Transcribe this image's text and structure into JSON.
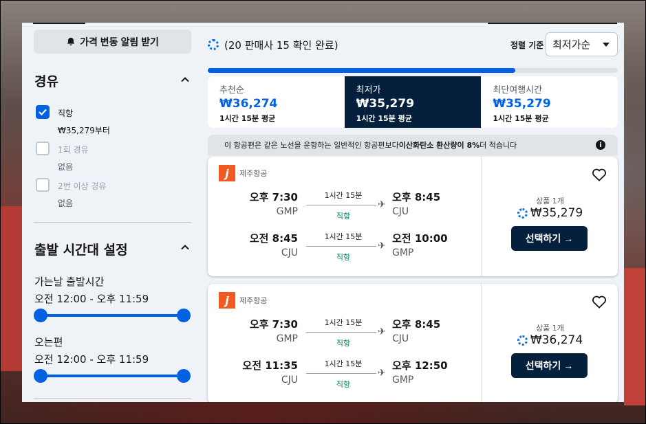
{
  "sidebar": {
    "alert_button": "가격 변동 알림 받기",
    "stops": {
      "title": "경유",
      "items": [
        {
          "label": "직항",
          "sub": "₩35,279부터",
          "checked": true,
          "disabled": false
        },
        {
          "label": "1회 경유",
          "sub": "없음",
          "checked": false,
          "disabled": true
        },
        {
          "label": "2번 이상 경유",
          "sub": "없음",
          "checked": false,
          "disabled": true
        }
      ]
    },
    "departure_times": {
      "title": "출발 시간대 설정",
      "outbound_label": "가는날 출발시간",
      "outbound_range": "오전 12:00 - 오후 11:59",
      "inbound_label": "오는편",
      "inbound_range": "오전 12:00 - 오후 11:59"
    }
  },
  "main": {
    "status": "(20 판매사 15 확인 완료)",
    "sort_label": "정렬 기준",
    "sort_value": "최저가순",
    "progress_fraction": 0.75,
    "tabs": [
      {
        "label": "추천순",
        "price": "₩36,274",
        "duration": "1시간 15분 평균",
        "active": false
      },
      {
        "label": "최저가",
        "price": "₩35,279",
        "duration": "1시간 15분 평균",
        "active": true
      },
      {
        "label": "최단여행시간",
        "price": "₩35,279",
        "duration": "1시간 15분 평균",
        "active": false
      }
    ],
    "eco_notice": {
      "prefix": "이 항공편은 같은 노선을 운항하는 일반적인 항공편보다 ",
      "highlight": "이산화탄소 환산량이 8%",
      "suffix": " 더 적습니다"
    },
    "results": [
      {
        "airline": "제주항공",
        "logo_letter": "j",
        "legs": [
          {
            "dep_time": "오후 7:30",
            "dep_code": "GMP",
            "duration": "1시간 15분",
            "stops": "직항",
            "arr_time": "오후 8:45",
            "arr_code": "CJU"
          },
          {
            "dep_time": "오전 8:45",
            "dep_code": "CJU",
            "duration": "1시간 15분",
            "stops": "직항",
            "arr_time": "오전 10:00",
            "arr_code": "GMP"
          }
        ],
        "deals": "상품 1개",
        "price": "₩35,279",
        "select_label": "선택하기 →"
      },
      {
        "airline": "제주항공",
        "logo_letter": "j",
        "legs": [
          {
            "dep_time": "오후 7:30",
            "dep_code": "GMP",
            "duration": "1시간 15분",
            "stops": "직항",
            "arr_time": "오후 8:45",
            "arr_code": "CJU"
          },
          {
            "dep_time": "오전 11:35",
            "dep_code": "CJU",
            "duration": "1시간 15분",
            "stops": "직항",
            "arr_time": "오후 12:50",
            "arr_code": "GMP"
          }
        ],
        "deals": "상품 1개",
        "price": "₩36,274",
        "select_label": "선택하기 →"
      }
    ]
  },
  "colors": {
    "accent": "#0062e3",
    "dark": "#05203c",
    "direct": "#00805c",
    "brand_jeju": "#f05a22"
  },
  "icons": [
    "bell-icon",
    "chevron-up-icon",
    "check-icon",
    "spinner-icon",
    "caret-down-icon",
    "info-icon",
    "plane-icon",
    "heart-icon"
  ]
}
